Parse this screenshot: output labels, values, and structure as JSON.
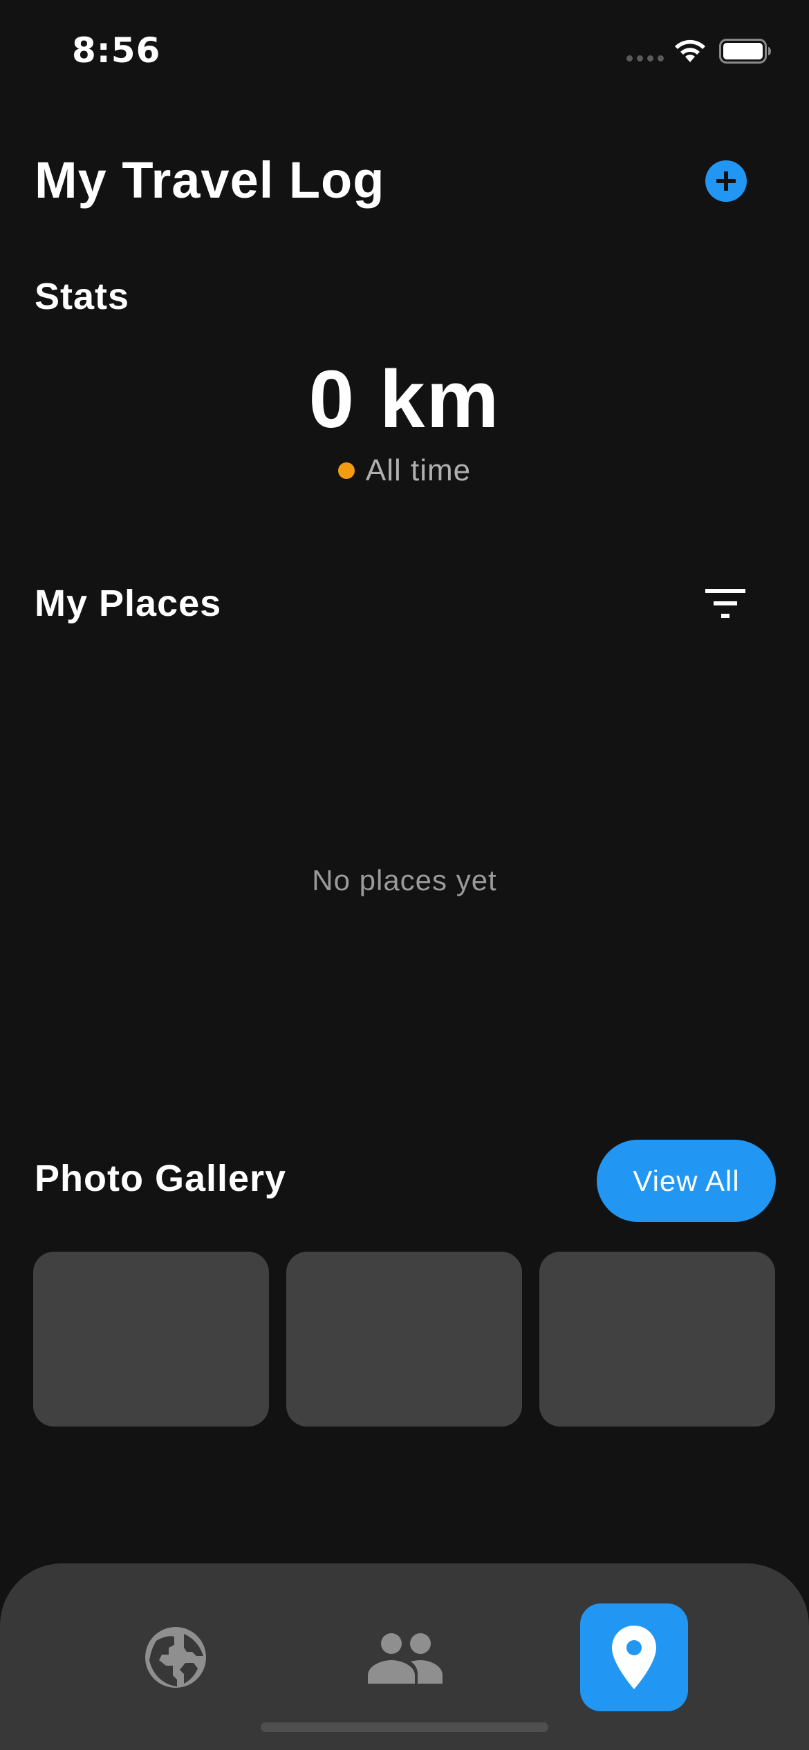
{
  "status_bar": {
    "time": "8:56"
  },
  "header": {
    "title": "My Travel Log",
    "add_icon": "plus-circle-icon"
  },
  "stats": {
    "title": "Stats",
    "distance": "0 km",
    "period_label": "All time",
    "period_dot_color": "#F39C12"
  },
  "places": {
    "title": "My Places",
    "filter_icon": "filter-icon",
    "empty_message": "No places yet"
  },
  "gallery": {
    "title": "Photo Gallery",
    "view_all_label": "View All",
    "tile_count": 3
  },
  "bottom_nav": {
    "items": [
      {
        "icon": "globe-icon",
        "active": false
      },
      {
        "icon": "people-icon",
        "active": false
      },
      {
        "icon": "location-pin-icon",
        "active": true
      }
    ]
  },
  "colors": {
    "accent": "#2196F3",
    "background": "#121212",
    "surface": "#383838",
    "tile": "#414141"
  }
}
